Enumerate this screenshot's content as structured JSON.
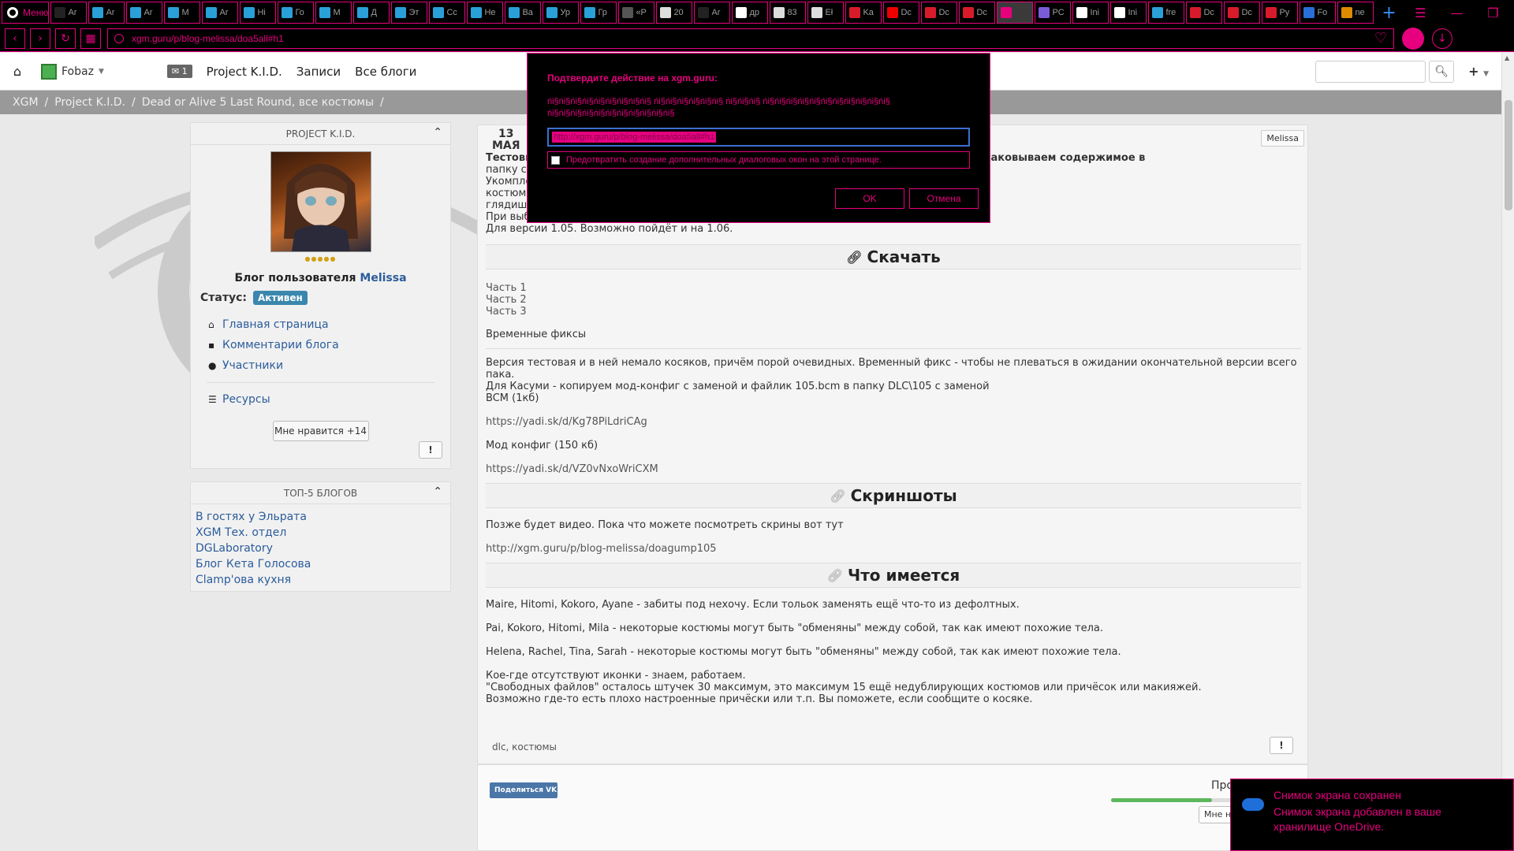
{
  "browser": {
    "menu_label": "Меню",
    "tabs": [
      {
        "label": "Ar",
        "color": "#222"
      },
      {
        "label": "Ar",
        "color": "#2aa0d8"
      },
      {
        "label": "Ar",
        "color": "#2aa0d8"
      },
      {
        "label": "M",
        "color": "#2aa0d8"
      },
      {
        "label": "Ar",
        "color": "#2aa0d8"
      },
      {
        "label": "Hi",
        "color": "#2aa0d8"
      },
      {
        "label": "Го",
        "color": "#2aa0d8"
      },
      {
        "label": "M",
        "color": "#2aa0d8"
      },
      {
        "label": "Д",
        "color": "#2aa0d8"
      },
      {
        "label": "Эт",
        "color": "#2aa0d8"
      },
      {
        "label": "Cc",
        "color": "#2aa0d8"
      },
      {
        "label": "He",
        "color": "#2aa0d8"
      },
      {
        "label": "Ba",
        "color": "#2aa0d8"
      },
      {
        "label": "Ур",
        "color": "#2aa0d8"
      },
      {
        "label": "Гр",
        "color": "#2aa0d8"
      },
      {
        "label": "«Р",
        "color": "#555"
      },
      {
        "label": "20",
        "color": "#ddd"
      },
      {
        "label": "Ar",
        "color": "#222"
      },
      {
        "label": "др",
        "color": "#fff"
      },
      {
        "label": "83",
        "color": "#ddd"
      },
      {
        "label": "Eł",
        "color": "#ddd"
      },
      {
        "label": "Ka",
        "color": "#d81b2b"
      },
      {
        "label": "Dc",
        "color": "#e00"
      },
      {
        "label": "Dc",
        "color": "#d81b2b"
      },
      {
        "label": "Dc",
        "color": "#d81b2b"
      },
      {
        "label": "",
        "color": "#e6007e"
      },
      {
        "label": "PC",
        "color": "#7a5cd8"
      },
      {
        "label": "Ini",
        "color": "#fff"
      },
      {
        "label": "Ini",
        "color": "#fff"
      },
      {
        "label": "fre",
        "color": "#2aa0d8"
      },
      {
        "label": "Dc",
        "color": "#d81b2b"
      },
      {
        "label": "Dc",
        "color": "#d81b2b"
      },
      {
        "label": "Py",
        "color": "#d81b2b"
      },
      {
        "label": "Fo",
        "color": "#2a6fd8"
      },
      {
        "label": "ne",
        "color": "#e08a00"
      }
    ],
    "url": "xgm.guru/p/blog-melissa/doa5all#h1"
  },
  "site_nav": {
    "username": "Fobaz",
    "messages_count": "1",
    "links": [
      "Project K.I.D.",
      "Записи",
      "Все блоги"
    ]
  },
  "breadcrumb": [
    "XGM",
    "/",
    "Project K.I.D.",
    "/",
    "Dead or Alive 5 Last Round, все костюмы",
    "/"
  ],
  "sidebar": {
    "project_title": "PROJECT K.I.D.",
    "stars": "●●●●●",
    "blog_of": "Блог пользователя",
    "owner": "Melissa",
    "status_label": "Статус:",
    "status_value": "Активен",
    "links": [
      {
        "icon": "⌂",
        "label": "Главная страница",
        "name": "home"
      },
      {
        "icon": "▪",
        "label": "Комментарии блога",
        "name": "comments"
      },
      {
        "icon": "●",
        "label": "Участники",
        "name": "members"
      }
    ],
    "resources": {
      "icon": "☰",
      "label": "Ресурсы"
    },
    "like_label": "Мне нравится +14",
    "excl": "!",
    "top5_title": "ТОП-5 БЛОГОВ",
    "top5": [
      "В гостях у Эльрата",
      "XGM Тех. отдел",
      "DGLaboratory",
      "Блог Кета Голосова",
      "Clamp'ова кухня"
    ]
  },
  "post": {
    "date_day": "13",
    "date_month": "МАЯ",
    "author_chip": "Melissa",
    "intro": {
      "line1": "Тестовый мод. Скачиваем все части, распаковываем первый архив по частям и распаковываем содержимое в",
      "line2": "папку с игрой. Всё.",
      "line3": "Укомплектовано всё (1700). Если быть точным - пока что в игре всего есть 1648",
      "line4": "костюмов (включая мужиков, чтобы и там все слоты заюзать - то и 2000",
      "line5": "глядишь ...",
      "line6": "При выборе случайного персонажа будут случайные причёски/очки/аксессуары.",
      "line7": "Для версии 1.05. Возможно пойдёт и на 1.06."
    },
    "download_title": "Скачать",
    "parts": [
      "Часть 1",
      "Часть 2",
      "Часть 3"
    ],
    "temp_fixes": "Временные фиксы",
    "fix_p1": "Версия тестовая и в ней немало косяков, причём порой очевидных. Временный фикс - чтобы не плеваться в ожидании окончательной версии всего",
    "fix_p2": "пака.",
    "fix_p3": "Для Касуми - копируем мод-конфиг с заменой и файлик 105.bcm в папку DLC\\105 с заменой",
    "fix_p4": "BCM (1кб)",
    "bcm_link": "https://yadi.sk/d/Kg78PiLdriCAg",
    "modcfg": "Мод конфиг (150 кб)",
    "modcfg_link": "https://yadi.sk/d/VZ0vNxoWriCXM",
    "shots_title": "Скриншоты",
    "shots_text": "Позже будет видео. Пока что можете посмотреть скрины вот тут",
    "shots_link": "http://xgm.guru/p/blog-melissa/doagump105",
    "have_title": "Что имеется",
    "have_p1": "Maire, Hitomi, Kokoro, Ayane - забиты под нехочу. Если тольок заменять ещё что-то из дефолтных.",
    "have_p2": "Pai, Kokoro, Hitomi, Mila - некоторые костюмы могут быть \"обменяны\" между собой, так как имеют похожие тела.",
    "have_p3": "Helena, Rachel, Tina, Sarah - некоторые костюмы могут быть \"обменяны\" между собой, так как имеют похожие тела.",
    "have_p4": "Кое-где отсутствуют иконки - знаем, работаем.",
    "have_p5": "\"Свободных файлов\" осталось штучек 30 максимум, это максимум 15 ещё недублирующих костюмов или причёсок или макияжей.",
    "have_p6": "Возможно где-то есть плохо настроенные причёски или т.п. Вы поможете, если сообщите о косяке.",
    "tags": "dlc, костюмы",
    "excl": "!"
  },
  "post_footer": {
    "share_vk": "Поделиться VK",
    "views_label": "Про",
    "progress": 0.8,
    "like_label": "Мне нр"
  },
  "dialog": {
    "title": "Подтвердите действие на xgm.guru:",
    "message": "ńi§ńi§ńi§ńi§ńi§ńi§ńi§ńi§ńi§ ńi§ńi§ńi§ńi§ńi§ńi§ ńi§ńi§ńi§ ńi§ńi§ńi§ńi§ńi§ńi§ńi§ńi§ńi§ńi§ńi§ ńi§ńi§ńi§ńi§ńi§ńi§ńi§ńi§ńi§ńi§ńi§",
    "input_value": "http://xgm.guru/p/blog-melissa/doa5all#h1",
    "checkbox_label": "Предотвратить создание дополнительных диалоговых окон на этой странице.",
    "ok": "OK",
    "cancel": "Отмена"
  },
  "toast": {
    "title": "Снимок экрана сохранен",
    "body": "Снимок экрана добавлен в ваше хранилище OneDrive."
  },
  "colors": {
    "accent": "#e6007e",
    "link": "#2b5c9b",
    "status": "#3a87ad",
    "vk": "#4a76a8"
  }
}
